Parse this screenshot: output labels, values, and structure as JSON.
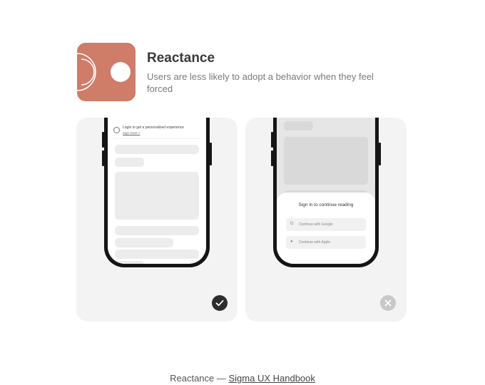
{
  "header": {
    "title": "Reactance",
    "subtitle": "Users are less likely to adopt a behavior when they feel forced",
    "logo_icon": "reactance-logo-icon",
    "accent_color": "#cf7c68"
  },
  "cards": {
    "good": {
      "login_prompt": "Login to get a personalized experience",
      "login_link": "Sign more >",
      "badge_icon": "checkmark-icon"
    },
    "bad": {
      "sheet_title": "Sign in to continue reading",
      "google_button": "Continue with Google",
      "apple_button": "Continue with Apple",
      "badge_icon": "close-icon"
    }
  },
  "caption": {
    "prefix": "Reactance — ",
    "link": "Sigma UX Handbook"
  }
}
